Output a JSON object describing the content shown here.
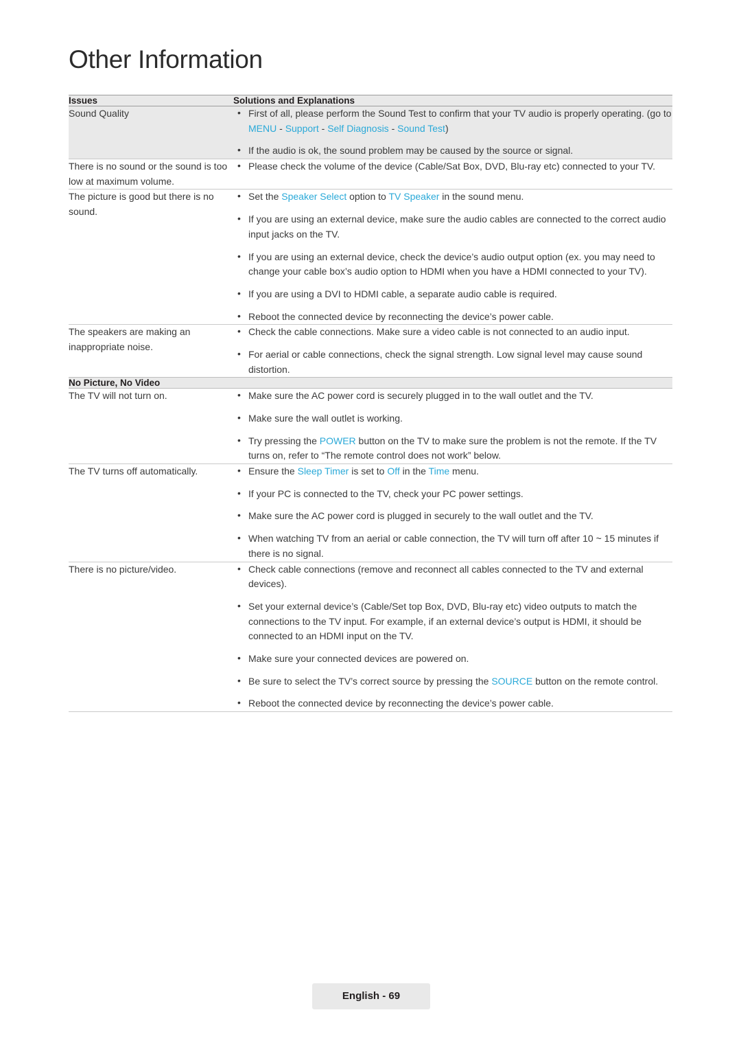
{
  "page": {
    "title": "Other Information",
    "footer_label": "English - 69",
    "accent_color": "#2aa9d8"
  },
  "table": {
    "headers": {
      "issues": "Issues",
      "solutions": "Solutions and Explanations"
    },
    "section_header": "No Picture, No Video",
    "rows": [
      {
        "issue": "Sound Quality",
        "solutions": [
          "First of all, please perform the Sound Test to confirm that your TV audio is properly operating. (go to MENU - Support - Self Diagnosis - Sound Test)",
          "If the audio is ok, the sound problem may be caused by the source or signal."
        ]
      },
      {
        "issue": "There is no sound or the sound is too low at maximum volume.",
        "solutions": [
          "Please check the volume of the device (Cable/Sat Box, DVD, Blu-ray etc) connected to your TV."
        ]
      },
      {
        "issue": "The picture is good but there is no sound.",
        "solutions": [
          "Set the Speaker Select option to TV Speaker in the sound menu.",
          "If you are using an external device, make sure the audio cables are connected to the correct audio input jacks on the TV.",
          "If you are using an external device, check the device’s audio output option (ex. you may need to change your cable box’s audio option to HDMI when you have a HDMI connected to your TV).",
          "If you are using a DVI to HDMI cable, a separate audio cable is required.",
          "Reboot the connected device by reconnecting the device’s power cable."
        ]
      },
      {
        "issue": "The speakers are making an inappropriate noise.",
        "solutions": [
          "Check the cable connections. Make sure a video cable is not connected to an audio input.",
          "For aerial or cable connections, check the signal strength. Low signal level may cause sound distortion."
        ]
      },
      {
        "issue": "The TV will not turn on.",
        "solutions": [
          "Make sure the AC power cord is securely plugged in to the wall outlet and the TV.",
          "Make sure the wall outlet is working.",
          "Try pressing the POWER button on the TV to make sure the problem is not the remote. If the TV turns on, refer to “The remote control does not work” below."
        ]
      },
      {
        "issue": "The TV turns off automatically.",
        "solutions": [
          "Ensure the Sleep Timer is set to Off in the Time menu.",
          "If your PC is connected to the TV, check your PC power settings.",
          "Make sure the AC power cord is plugged in securely to the wall outlet and the TV.",
          "When watching TV from an aerial or cable connection, the TV will turn off after 10 ~ 15 minutes if there is no signal."
        ]
      },
      {
        "issue": "There is no picture/video.",
        "solutions": [
          "Check cable connections (remove and reconnect all cables connected to the TV and external devices).",
          "Set your external device’s (Cable/Set top Box, DVD, Blu-ray etc) video outputs to match the connections to the TV input. For example, if an external device’s output is HDMI, it should be connected to an HDMI input on the TV.",
          "Make sure your connected devices are powered on.",
          "Be sure to select the TV’s correct source by pressing the SOURCE button on the remote control.",
          "Reboot the connected device by reconnecting the device’s power cable."
        ]
      }
    ]
  },
  "highlighted_terms": {
    "menu": "MENU",
    "support": "Support",
    "self_diagnosis": "Self Diagnosis",
    "sound_test": "Sound Test",
    "speaker_select": "Speaker Select",
    "tv_speaker": "TV Speaker",
    "power": "POWER",
    "sleep_timer": "Sleep Timer",
    "off": "Off",
    "time": "Time",
    "source": "SOURCE"
  }
}
